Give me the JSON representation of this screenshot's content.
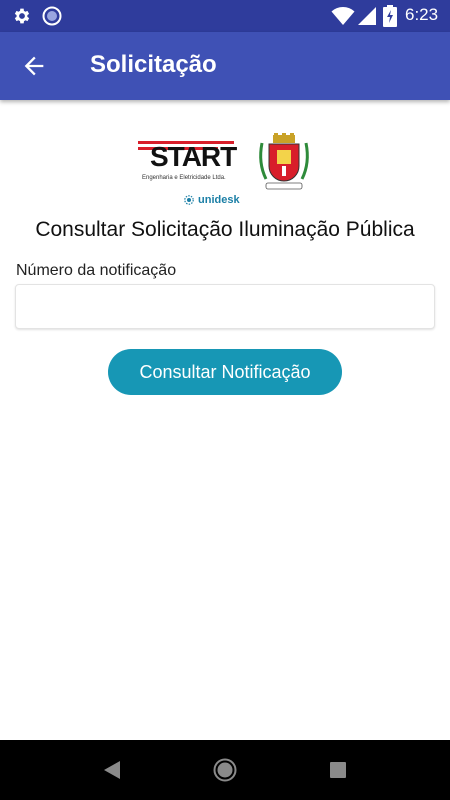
{
  "status_bar": {
    "time": "6:23",
    "icons": [
      "gear-icon",
      "disc-icon",
      "wifi-icon",
      "cell-signal-icon",
      "battery-icon"
    ]
  },
  "app_bar": {
    "title": "Solicitação",
    "back_icon": "arrow-back-icon"
  },
  "logos": {
    "start_word": "START",
    "start_sub": "Engenharia e Eletricidade Ltda.",
    "unidesk": "unidesk",
    "crest_icon": "municipal-crest-icon"
  },
  "form": {
    "heading": "Consultar Solicitação Iluminação Pública",
    "field_label": "Número da notificação",
    "field_value": "",
    "field_placeholder": "",
    "button_label": "Consultar Notificação"
  },
  "nav_bar": {
    "icons": [
      "nav-back-icon",
      "nav-home-icon",
      "nav-recent-icon"
    ]
  },
  "colors": {
    "status_bar": "#2f3c9c",
    "app_bar": "#3f51b5",
    "button": "#1797b5",
    "brand_red": "#d81e2a",
    "nav_bar": "#000000"
  }
}
